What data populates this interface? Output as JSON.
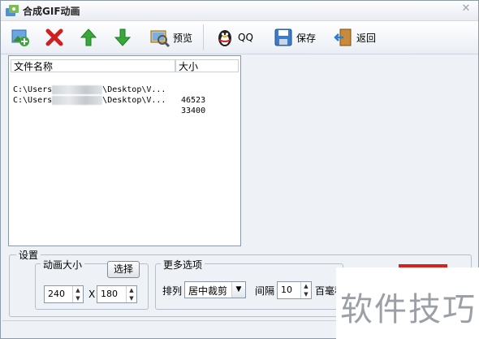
{
  "window": {
    "title": "合成GIF动画",
    "close_glyph": "✕"
  },
  "toolbar": {
    "add_icon": "add-image-icon",
    "delete_icon": "red-x-icon",
    "up_icon": "green-up-arrow-icon",
    "down_icon": "green-down-arrow-icon",
    "preview_label": "预览",
    "qq_label": "QQ",
    "save_label": "保存",
    "back_label": "返回"
  },
  "file_list": {
    "columns": [
      "文件名称",
      "大小"
    ],
    "rows": [
      {
        "path_start": "C:\\Users",
        "path_end": "\\Desktop\\V...",
        "size": "46523"
      },
      {
        "path_start": "C:\\Users",
        "path_end": "\\Desktop\\V...",
        "size": "33400"
      }
    ]
  },
  "settings": {
    "title": "设置",
    "animation_size": {
      "title": "动画大小",
      "select_label": "选择",
      "width": "240",
      "x_label": "X",
      "height": "180"
    },
    "more_options": {
      "title": "更多选项",
      "arrange_label": "排列",
      "arrange_value": "居中裁剪",
      "interval_label": "间隔",
      "interval_value": "10",
      "unit_label": "百毫秒"
    }
  },
  "watermark": "软件技巧",
  "colors": {
    "accent_red": "#d9201f",
    "window_bg": "#eef1f6"
  }
}
